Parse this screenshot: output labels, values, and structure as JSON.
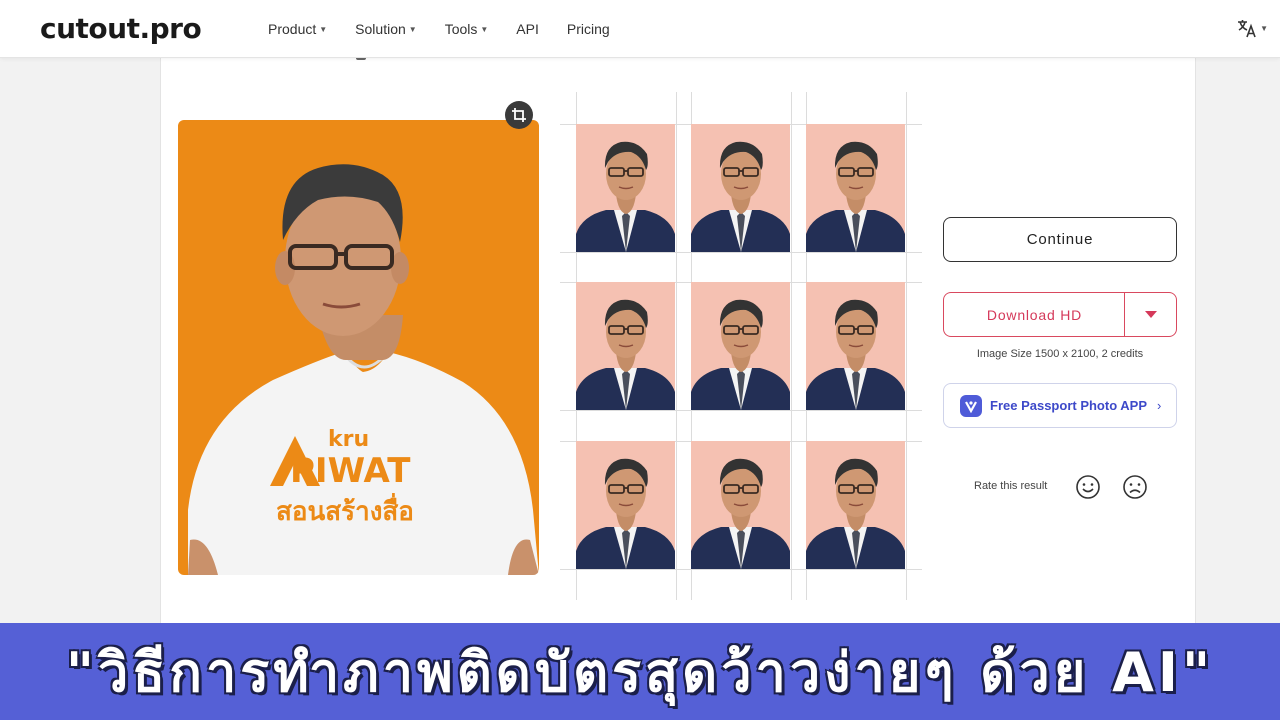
{
  "header": {
    "logo": "cutout.pro",
    "nav": [
      {
        "label": "Product",
        "has_dropdown": true
      },
      {
        "label": "Solution",
        "has_dropdown": true
      },
      {
        "label": "Tools",
        "has_dropdown": true
      },
      {
        "label": "API",
        "has_dropdown": false
      },
      {
        "label": "Pricing",
        "has_dropdown": false
      }
    ],
    "language_icon": "translate-icon"
  },
  "editor": {
    "original_photo": {
      "background_color": "#ec8a16",
      "shirt_text_small": "kru",
      "shirt_text_large": "PIWAT",
      "shirt_text_thai": "สอนสร้างสื่อ"
    },
    "crop_icon": "crop-icon",
    "passport_grid": {
      "rows": 3,
      "columns": 3,
      "photo_background": "#f5c1b2"
    }
  },
  "actions": {
    "continue_label": "Continue",
    "download_label": "Download HD",
    "dropdown_icon": "caret-down-icon",
    "size_info": "Image Size 1500 x 2100, 2 credits",
    "app_label": "Free Passport Photo APP",
    "app_chevron": "›",
    "rate_label": "Rate this result",
    "rate_icons": [
      "smile-icon",
      "frown-icon"
    ]
  },
  "banner": {
    "text": "\"วิธีการทำภาพติดบัตรสุดว้าวง่ายๆ ด้วย AI\"",
    "background": "#5560d6"
  },
  "colors": {
    "accent_download": "#d5395a",
    "accent_app": "#3d49c9"
  }
}
